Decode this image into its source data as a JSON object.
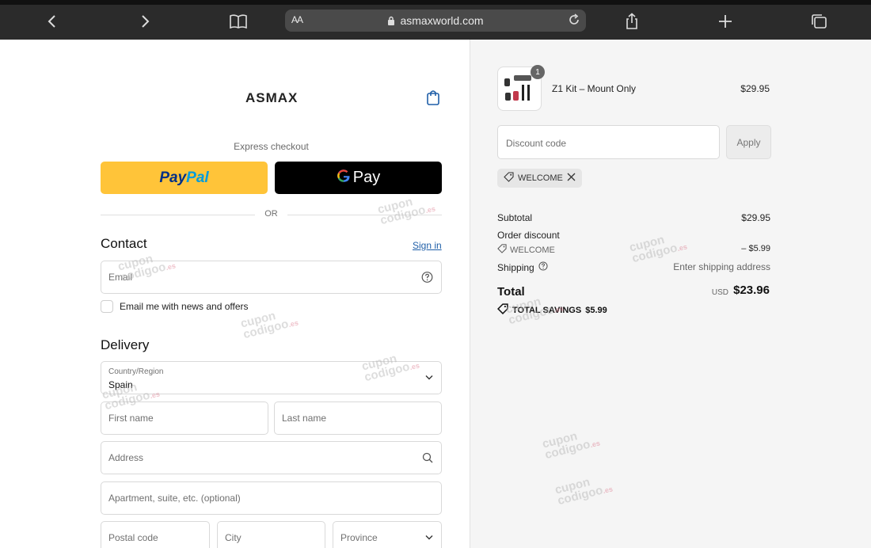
{
  "browser": {
    "url": "asmaxworld.com",
    "text_size_label": "AA"
  },
  "header": {
    "logo": "ASMAX"
  },
  "express": {
    "label": "Express checkout",
    "paypal_part1": "Pay",
    "paypal_part2": "Pal",
    "gpay_g": "G",
    "gpay_label": "Pay",
    "or_label": "OR"
  },
  "contact": {
    "title": "Contact",
    "sign_in": "Sign in",
    "email_placeholder": "Email",
    "newsletter_label": "Email me with news and offers"
  },
  "delivery": {
    "title": "Delivery",
    "country_label": "Country/Region",
    "country_value": "Spain",
    "first_name_placeholder": "First name",
    "last_name_placeholder": "Last name",
    "address_placeholder": "Address",
    "apartment_placeholder": "Apartment, suite, etc. (optional)",
    "postal_placeholder": "Postal code",
    "city_placeholder": "City",
    "province_placeholder": "Province"
  },
  "order": {
    "item_quantity": "1",
    "item_name": "Z1 Kit – Mount Only",
    "item_price": "$29.95",
    "discount_placeholder": "Discount code",
    "apply_label": "Apply",
    "applied_code": "WELCOME",
    "subtotal_label": "Subtotal",
    "subtotal_value": "$29.95",
    "order_discount_label": "Order discount",
    "discount_code": "WELCOME",
    "discount_value": "– $5.99",
    "shipping_label": "Shipping",
    "shipping_value": "Enter shipping address",
    "total_label": "Total",
    "total_currency": "USD",
    "total_value": "$23.96",
    "savings_label": "TOTAL SAVINGS",
    "savings_value": "$5.99"
  },
  "watermark": {
    "line1": "cupon",
    "line2": "codigoo",
    "suffix": ".es"
  },
  "colors": {
    "paypal_yellow": "#ffc439",
    "paypal_dark": "#003087",
    "paypal_light": "#009cde",
    "link_blue": "#1f5fa8",
    "summary_bg": "#f5f5f5"
  }
}
